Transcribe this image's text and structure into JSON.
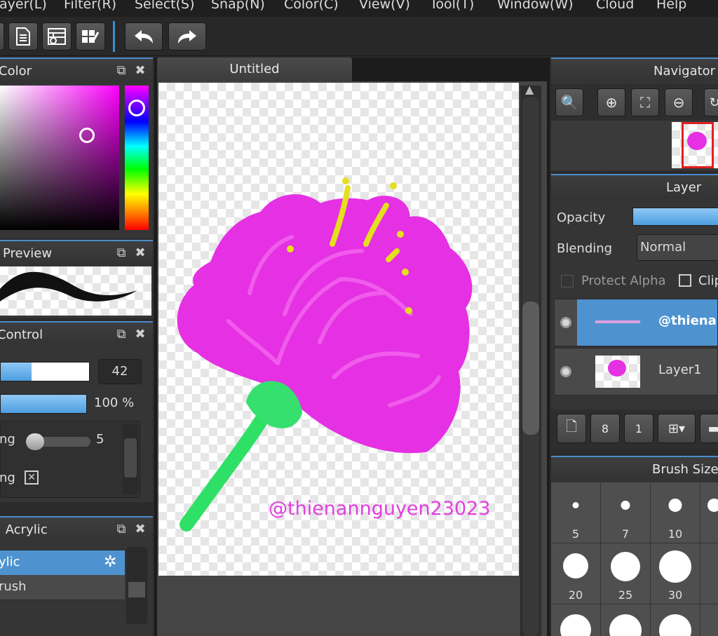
{
  "menu": [
    "ayer(L)",
    "Filter(R)",
    "Select(S)",
    "Snap(N)",
    "Color(C)",
    "View(V)",
    "Tool(T)",
    "Window(W)",
    "Cloud",
    "Help"
  ],
  "toolbar": {
    "icons": [
      "file-icon",
      "layout-grid-icon",
      "grid-settings-icon",
      "undo-icon",
      "redo-icon"
    ]
  },
  "document_tab": {
    "title": "Untitled"
  },
  "color_panel": {
    "title": "Color"
  },
  "preview_panel": {
    "title": "Preview"
  },
  "brush_control": {
    "title": "Control",
    "size_value": "42",
    "size_fraction": 0.35,
    "opacity_value": "100 %",
    "opacity_fraction": 1.0,
    "row1_label": "ng",
    "row1_value": "5",
    "row2_label": "ng",
    "row2_checked": true
  },
  "brush_list": {
    "title": ": Acrylic",
    "items": [
      {
        "label": "ylic",
        "selected": true
      },
      {
        "label": "rush",
        "selected": false
      }
    ]
  },
  "navigator": {
    "title": "Navigator"
  },
  "layer_panel": {
    "title": "Layer",
    "opacity_label": "Opacity",
    "opacity_fraction": 1.0,
    "blending_label": "Blending",
    "blending_value": "Normal",
    "protect_alpha_label": "Protect Alpha",
    "clip_label": "Clip",
    "layers": [
      {
        "name": "@thiena",
        "selected": true
      },
      {
        "name": "Layer1",
        "selected": false
      }
    ]
  },
  "brush_size": {
    "title": "Brush Size",
    "sizes": [
      "5",
      "7",
      "10",
      "20",
      "25",
      "30"
    ]
  },
  "canvas": {
    "watermark": "@thienannguyen23023"
  },
  "colors": {
    "accent": "#4b8ccc",
    "flower": "#e22fe0",
    "stem": "#2ee06a",
    "stamen": "#e8e21c"
  }
}
